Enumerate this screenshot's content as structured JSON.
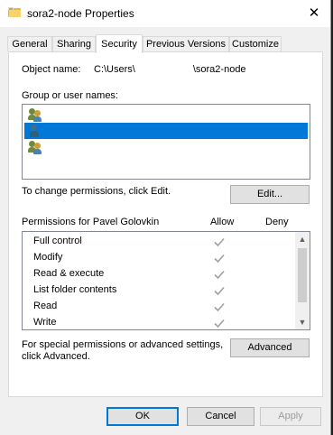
{
  "window": {
    "title": "sora2-node Properties",
    "close_glyph": "✕"
  },
  "tabs": [
    {
      "label": "General"
    },
    {
      "label": "Sharing"
    },
    {
      "label": "Security"
    },
    {
      "label": "Previous Versions"
    },
    {
      "label": "Customize"
    }
  ],
  "active_tab": "Security",
  "security": {
    "object_label": "Object name:",
    "object_path_prefix": "C:\\Users\\",
    "object_path_suffix": "\\sora2-node",
    "groups_label": "Group or user names:",
    "groups": [
      {
        "name": "",
        "selected": false
      },
      {
        "name": "",
        "selected": true
      },
      {
        "name": "",
        "selected": false
      }
    ],
    "change_text": "To change permissions, click Edit.",
    "edit_button": "Edit...",
    "permissions_for": "Permissions for Pavel Golovkin",
    "allow_header": "Allow",
    "deny_header": "Deny",
    "permissions": [
      {
        "name": "Full control",
        "allow": true,
        "deny": false
      },
      {
        "name": "Modify",
        "allow": true,
        "deny": false
      },
      {
        "name": "Read & execute",
        "allow": true,
        "deny": false
      },
      {
        "name": "List folder contents",
        "allow": true,
        "deny": false
      },
      {
        "name": "Read",
        "allow": true,
        "deny": false
      },
      {
        "name": "Write",
        "allow": true,
        "deny": false
      }
    ],
    "special_text_1": "For special permissions or advanced settings,",
    "special_text_2": "click Advanced.",
    "advanced_button": "Advanced"
  },
  "buttons": {
    "ok": "OK",
    "cancel": "Cancel",
    "apply": "Apply"
  },
  "colors": {
    "selection": "#0078d7",
    "checkmark": "#a0a0a0"
  },
  "icons": {
    "folder": "folder-icon",
    "close": "close-icon",
    "users": "users-icon",
    "user": "user-icon",
    "check": "checkmark-icon"
  }
}
